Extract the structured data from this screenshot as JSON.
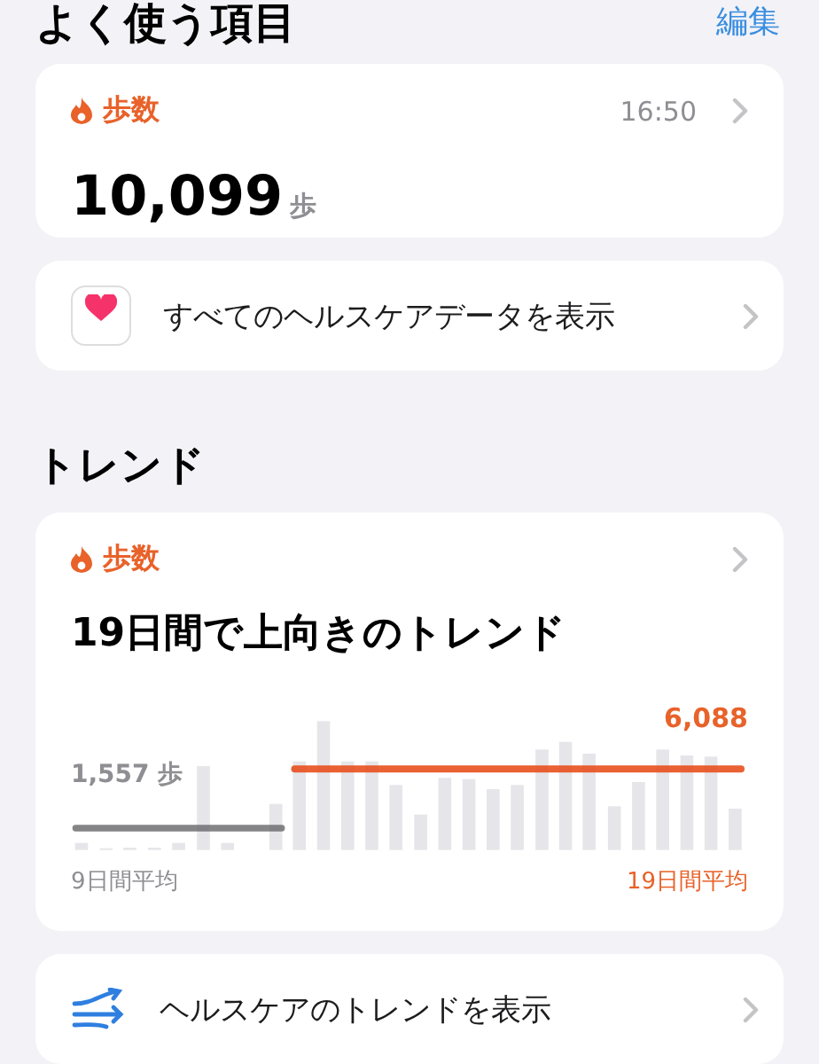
{
  "header": {
    "title": "よく使う項目",
    "edit": "編集"
  },
  "favorites": [
    {
      "kind": "metric",
      "category": "歩数",
      "time": "16:50",
      "value": "10,099",
      "unit": "歩"
    },
    {
      "kind": "link",
      "label": "すべてのヘルスケアデータを表示"
    }
  ],
  "trends": {
    "title": "トレンド",
    "card": {
      "category": "歩数",
      "headline": "19日間で上向きのトレンド",
      "previous_average": {
        "value": "1,557",
        "unit": "歩",
        "label": "9日間平均"
      },
      "current_average": {
        "value": "6,088",
        "label": "19日間平均"
      }
    },
    "link": {
      "label": "ヘルスケアのトレンドを表示"
    }
  }
}
